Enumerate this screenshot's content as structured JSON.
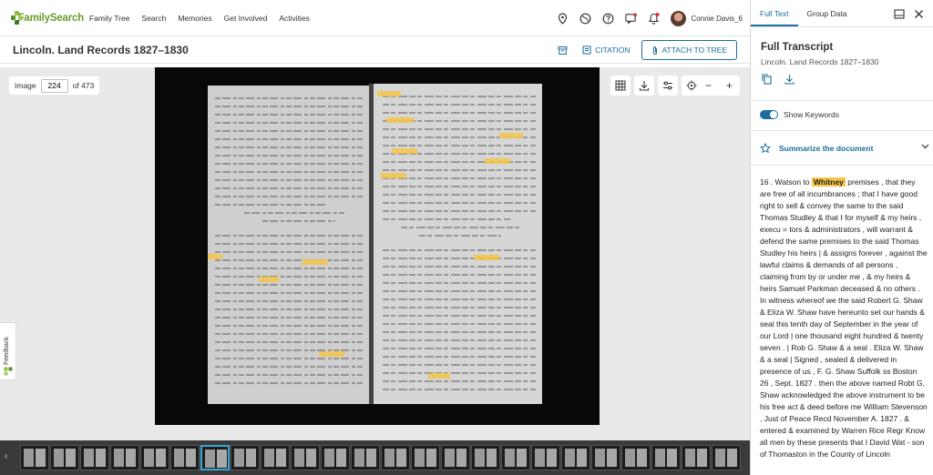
{
  "brand": {
    "name": "FamilySearch"
  },
  "nav": {
    "links": [
      "Family Tree",
      "Search",
      "Memories",
      "Get Involved",
      "Activities"
    ],
    "user_name": "Connie Davis_6"
  },
  "header": {
    "title": "Lincoln. Land Records 1827–1830",
    "citation_label": "CITATION",
    "attach_label": "ATTACH TO TREE"
  },
  "viewer": {
    "image_label": "Image",
    "image_number": "224",
    "of_total": "of 473",
    "zoom_out": "−",
    "zoom_in": "+"
  },
  "feedback": {
    "label": "Feedback"
  },
  "panel": {
    "tabs": [
      "Full Text",
      "Group Data"
    ],
    "active_tab": "Full Text",
    "title": "Full Transcript",
    "subtitle": "Lincoln. Land Records 1827–1830",
    "show_keywords_label": "Show Keywords",
    "show_keywords_on": true,
    "summarize_label": "Summarize the document",
    "transcript_before": "16 . Watson to ",
    "transcript_keyword": "Whitney",
    "transcript_after": " premises , that they are free of all incumbrances ; that I have good right to sell & convey the same to the said Thomas Studley & that I for myself & my heirs , execu = tors & administrators , will warrant & defend the same premises to the said Thomas Studley his heirs  |  & assigns forever , against the lawful claims & demands of all persons , claiming from by or under me , & my heirs & heirs Samuel Parkman deceased & no others . In witness whereof we the said Robert G. Shaw & Eliza W. Shaw have hereunto set our hands & seal this tenth day of September in the year of our Lord  |  one thousand eight hundred & twenty seven .  |  Rob G. Shaw & a seal . Eliza W. Shaw & a seal  |  Signed , sealed & delivered in presence of us , F. G. Shaw Suffolk ss Boston 26 , Sept. 1827 . then the above named Robt G. Shaw acknowledged the above instrument to be his free act & deed before me William Stevenson , Just of Peace Recd November A. 1827 . & entered & examined by Warren Rice Regr Know all men by these presents that I David Wat - son of Thomaston in the County of Lincoln"
  },
  "colors": {
    "accent": "#1b6e9e",
    "keyword_highlight": "#f4c64a",
    "brand_green": "#6a9a2e"
  }
}
